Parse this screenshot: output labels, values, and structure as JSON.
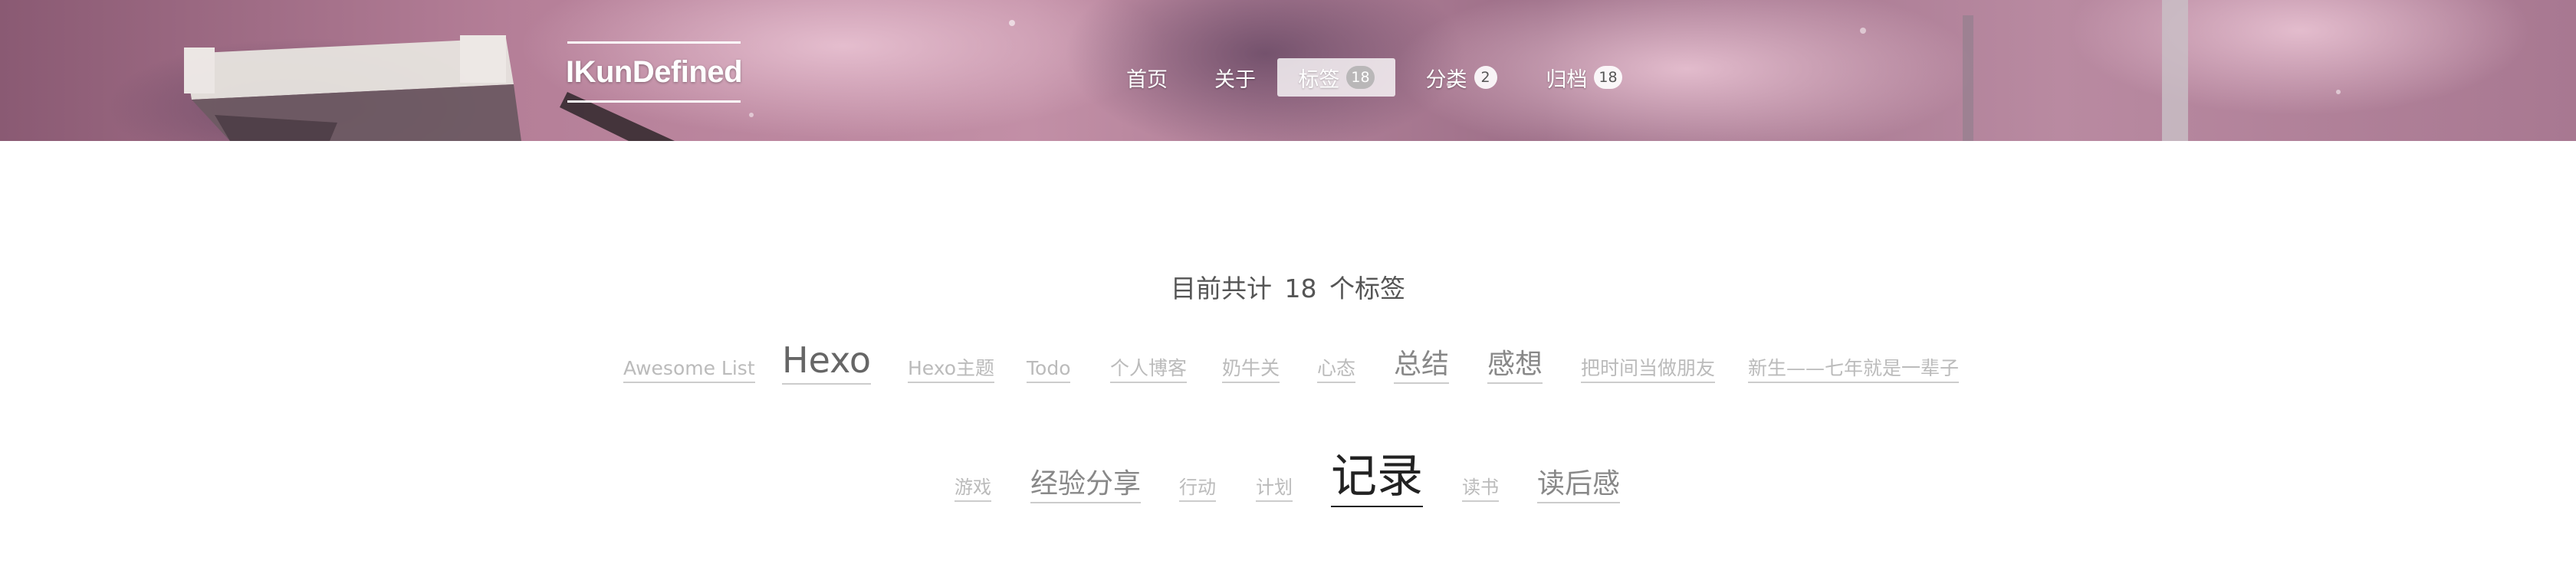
{
  "site": {
    "title": "IKunDefined"
  },
  "nav": [
    {
      "label": "首页",
      "badge": null,
      "active": false
    },
    {
      "label": "关于",
      "badge": null,
      "active": false
    },
    {
      "label": "标签",
      "badge": "18",
      "active": true
    },
    {
      "label": "分类",
      "badge": "2",
      "active": false
    },
    {
      "label": "归档",
      "badge": "18",
      "active": false
    }
  ],
  "tags_summary": {
    "prefix": "目前共计",
    "count": "18",
    "suffix": "个标签"
  },
  "tags": [
    {
      "name": "Awesome List",
      "color": "#bbbbbb"
    },
    {
      "name": "Hexo",
      "color": "#666666"
    },
    {
      "name": "Hexo主题",
      "color": "#bbbbbb"
    },
    {
      "name": "Todo",
      "color": "#bbbbbb"
    },
    {
      "name": "个人博客",
      "color": "#bbbbbb"
    },
    {
      "name": "奶牛关",
      "color": "#bbbbbb"
    },
    {
      "name": "心态",
      "color": "#bbbbbb"
    },
    {
      "name": "总结",
      "color": "#888888"
    },
    {
      "name": "感想",
      "color": "#888888"
    },
    {
      "name": "把时间当做朋友",
      "color": "#bbbbbb"
    },
    {
      "name": "新生——七年就是一辈子",
      "color": "#bbbbbb"
    },
    {
      "name": "游戏",
      "color": "#bbbbbb"
    },
    {
      "name": "经验分享",
      "color": "#888888"
    },
    {
      "name": "行动",
      "color": "#bbbbbb"
    },
    {
      "name": "计划",
      "color": "#bbbbbb"
    },
    {
      "name": "记录",
      "color": "#222222"
    },
    {
      "name": "读书",
      "color": "#bbbbbb"
    },
    {
      "name": "读后感",
      "color": "#888888"
    }
  ]
}
